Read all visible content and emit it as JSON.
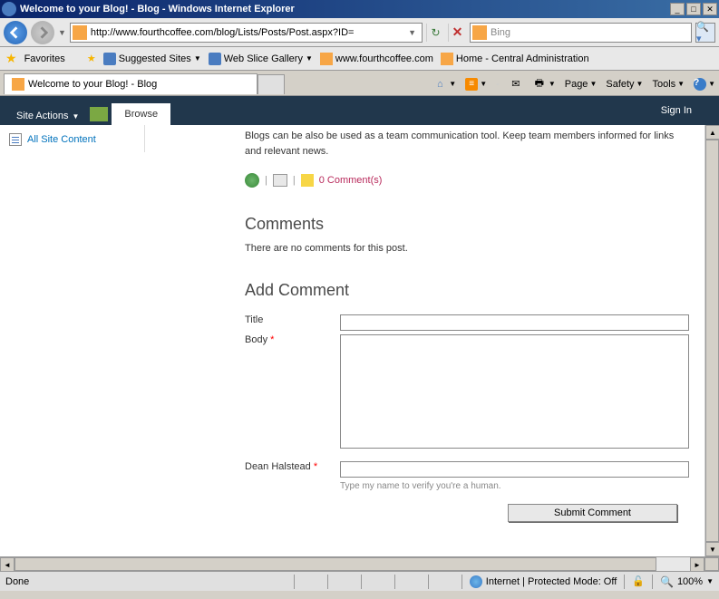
{
  "titlebar": {
    "text": "Welcome to your Blog! - Blog - Windows Internet Explorer"
  },
  "navbar": {
    "url": "http://www.fourthcoffee.com/blog/Lists/Posts/Post.aspx?ID=",
    "search_placeholder": "Bing"
  },
  "favbar": {
    "favorites_label": "Favorites",
    "items": [
      {
        "label": "Suggested Sites"
      },
      {
        "label": "Web Slice Gallery"
      },
      {
        "label": "www.fourthcoffee.com"
      },
      {
        "label": "Home - Central Administration"
      }
    ]
  },
  "tab": {
    "title": "Welcome to your Blog! - Blog"
  },
  "tools": {
    "page": "Page",
    "safety": "Safety",
    "tools": "Tools"
  },
  "ribbon": {
    "site_actions": "Site Actions",
    "browse": "Browse",
    "sign_in": "Sign In"
  },
  "sidebar": {
    "all_content": "All Site Content"
  },
  "content": {
    "blog_text": "Blogs can be also be used as a team communication tool. Keep team members informed for links and relevant news.",
    "comment_link": "0 Comment(s)",
    "comments_hdr": "Comments",
    "no_comments": "There are no comments for this post.",
    "add_comment_hdr": "Add Comment",
    "title_label": "Title",
    "body_label": "Body",
    "human_label": "Dean Halstead",
    "human_hint": "Type my name to verify you're a human.",
    "submit_label": "Submit Comment"
  },
  "statusbar": {
    "status": "Done",
    "zone": "Internet | Protected Mode: Off",
    "zoom": "100%"
  }
}
